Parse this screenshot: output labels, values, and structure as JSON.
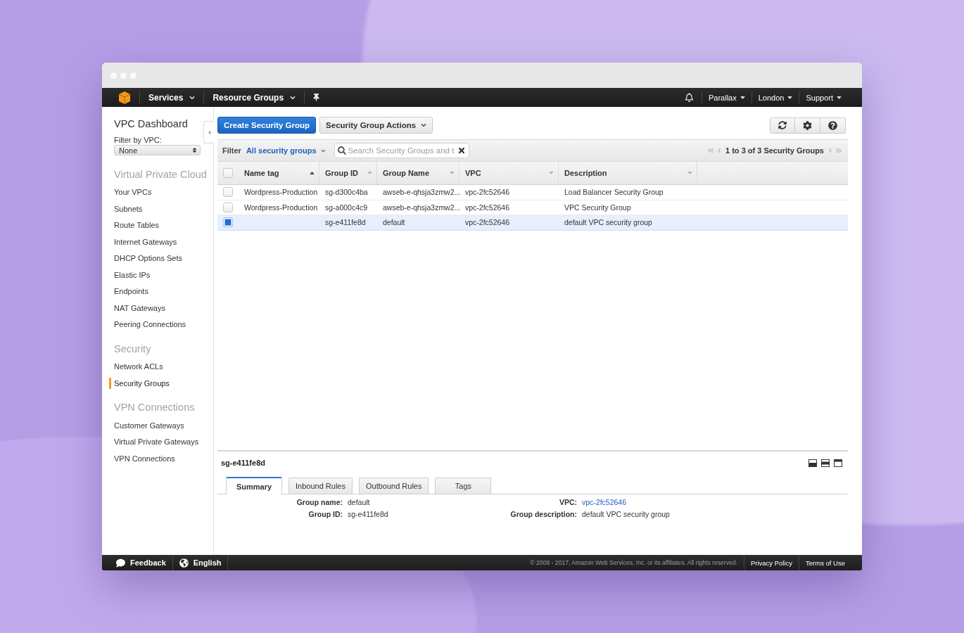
{
  "nav": {
    "menus": [
      {
        "label": "Services"
      },
      {
        "label": "Resource Groups"
      }
    ],
    "account_menus": [
      {
        "label": "Parallax"
      },
      {
        "label": "London"
      },
      {
        "label": "Support"
      }
    ]
  },
  "sidebar": {
    "title": "VPC Dashboard",
    "filter_label": "Filter by VPC:",
    "filter_value": "None",
    "sections": [
      {
        "heading": "Virtual Private Cloud",
        "items": [
          {
            "label": "Your VPCs",
            "selected": false
          },
          {
            "label": "Subnets",
            "selected": false
          },
          {
            "label": "Route Tables",
            "selected": false
          },
          {
            "label": "Internet Gateways",
            "selected": false
          },
          {
            "label": "DHCP Options Sets",
            "selected": false
          },
          {
            "label": "Elastic IPs",
            "selected": false
          },
          {
            "label": "Endpoints",
            "selected": false
          },
          {
            "label": "NAT Gateways",
            "selected": false
          },
          {
            "label": "Peering Connections",
            "selected": false
          }
        ]
      },
      {
        "heading": "Security",
        "items": [
          {
            "label": "Network ACLs",
            "selected": false
          },
          {
            "label": "Security Groups",
            "selected": true
          }
        ]
      },
      {
        "heading": "VPN Connections",
        "items": [
          {
            "label": "Customer Gateways",
            "selected": false
          },
          {
            "label": "Virtual Private Gateways",
            "selected": false
          },
          {
            "label": "VPN Connections",
            "selected": false
          }
        ]
      }
    ]
  },
  "toolbar": {
    "create_button": "Create Security Group",
    "actions_button": "Security Group Actions"
  },
  "filter_bar": {
    "label": "Filter",
    "filter_value": "All security groups",
    "search": {
      "placeholder": "Search Security Groups and t"
    },
    "pagination": "1 to 3 of 3 Security Groups"
  },
  "table": {
    "select_all": false,
    "columns": [
      {
        "label": "Name tag",
        "sorted": true
      },
      {
        "label": "Group ID",
        "sorted": false
      },
      {
        "label": "Group Name",
        "sorted": false
      },
      {
        "label": "VPC",
        "sorted": false
      },
      {
        "label": "Description",
        "sorted": false
      }
    ],
    "rows": [
      {
        "selected": false,
        "name_tag": "Wordpress-Production",
        "group_id": "sg-d300c4ba",
        "group_name": "awseb-e-qhsja3zmw2...",
        "vpc": "vpc-2fc52646",
        "description": "Load Balancer Security Group"
      },
      {
        "selected": false,
        "name_tag": "Wordpress-Production",
        "group_id": "sg-a000c4c9",
        "group_name": "awseb-e-qhsja3zmw2...",
        "vpc": "vpc-2fc52646",
        "description": "VPC Security Group"
      },
      {
        "selected": true,
        "group_id": "sg-e411fe8d",
        "group_name": "default",
        "vpc": "vpc-2fc52646",
        "description": "default VPC security group"
      }
    ]
  },
  "details": {
    "title": "sg-e411fe8d",
    "tabs": [
      {
        "label": "Summary",
        "selected": true
      },
      {
        "label": "Inbound Rules",
        "selected": false
      },
      {
        "label": "Outbound Rules",
        "selected": false
      },
      {
        "label": "Tags",
        "selected": false
      }
    ],
    "fields": [
      {
        "label": "Group name:",
        "value": "default",
        "kind": "text"
      },
      {
        "label": "VPC:",
        "value": "vpc-2fc52646",
        "kind": "link"
      },
      {
        "label": "Group ID:",
        "value": "sg-e411fe8d",
        "kind": "text"
      },
      {
        "label": "Group description:",
        "value": "default VPC security group",
        "kind": "text"
      }
    ]
  },
  "footer": {
    "feedback": "Feedback",
    "language": "English",
    "copyright": "© 2008 - 2017, Amazon Web Services, Inc. or its affiliates. All rights reserved.",
    "links": [
      "Privacy Policy",
      "Terms of Use"
    ]
  }
}
